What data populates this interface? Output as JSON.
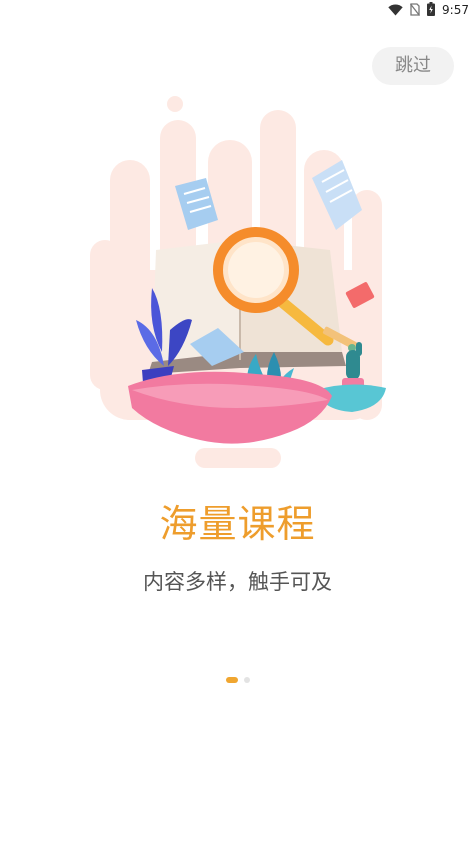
{
  "status_bar": {
    "time": "9:57",
    "icons": [
      "wifi-icon",
      "no-sim-icon",
      "battery-charging-icon"
    ]
  },
  "skip_label": "跳过",
  "illustration": {
    "subject": "open-book-with-magnifier"
  },
  "title": "海量课程",
  "subtitle": "内容多样，触手可及",
  "pager": {
    "count": 2,
    "active_index": 0,
    "colors": {
      "active": "#f0a630",
      "inactive": "#e3e3e3"
    }
  },
  "colors": {
    "accent": "#ee9d2c",
    "text_secondary": "#555555",
    "skip_background": "#f2f2f2",
    "skip_text": "#888888"
  }
}
